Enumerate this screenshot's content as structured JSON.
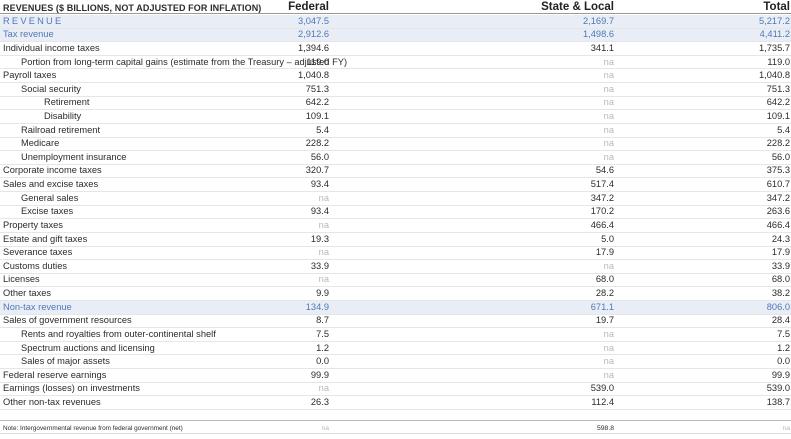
{
  "header": {
    "caption": "REVENUES ($ BILLIONS, NOT ADJUSTED FOR INFLATION)",
    "federal": "Federal",
    "state_local": "State & Local",
    "total": "Total"
  },
  "rows": [
    {
      "label": "REVENUE",
      "indent": 0,
      "federal": "3,047.5",
      "state_local": "2,169.7",
      "total": "5,217.2",
      "highlight": true
    },
    {
      "label": "Tax revenue",
      "indent": 0,
      "federal": "2,912.6",
      "state_local": "1,498.6",
      "total": "4,411.2",
      "highlight": true
    },
    {
      "label": "Individual income taxes",
      "indent": 0,
      "federal": "1,394.6",
      "state_local": "341.1",
      "total": "1,735.7"
    },
    {
      "label": "Portion from long-term capital gains (estimate from the Treasury – adjusted FY)",
      "indent": 1,
      "federal": "119.0",
      "state_local": "na",
      "total": "119.0"
    },
    {
      "label": "Payroll taxes",
      "indent": 0,
      "federal": "1,040.8",
      "state_local": "na",
      "total": "1,040.8"
    },
    {
      "label": "Social security",
      "indent": 1,
      "federal": "751.3",
      "state_local": "na",
      "total": "751.3"
    },
    {
      "label": "Retirement",
      "indent": 2,
      "federal": "642.2",
      "state_local": "na",
      "total": "642.2"
    },
    {
      "label": "Disability",
      "indent": 2,
      "federal": "109.1",
      "state_local": "na",
      "total": "109.1"
    },
    {
      "label": "Railroad retirement",
      "indent": 1,
      "federal": "5.4",
      "state_local": "na",
      "total": "5.4"
    },
    {
      "label": "Medicare",
      "indent": 1,
      "federal": "228.2",
      "state_local": "na",
      "total": "228.2"
    },
    {
      "label": "Unemployment insurance",
      "indent": 1,
      "federal": "56.0",
      "state_local": "na",
      "total": "56.0"
    },
    {
      "label": "Corporate income taxes",
      "indent": 0,
      "federal": "320.7",
      "state_local": "54.6",
      "total": "375.3"
    },
    {
      "label": "Sales and excise taxes",
      "indent": 0,
      "federal": "93.4",
      "state_local": "517.4",
      "total": "610.7"
    },
    {
      "label": "General sales",
      "indent": 1,
      "federal": "na",
      "state_local": "347.2",
      "total": "347.2"
    },
    {
      "label": "Excise taxes",
      "indent": 1,
      "federal": "93.4",
      "state_local": "170.2",
      "total": "263.6"
    },
    {
      "label": "Property taxes",
      "indent": 0,
      "federal": "na",
      "state_local": "466.4",
      "total": "466.4"
    },
    {
      "label": "Estate and gift taxes",
      "indent": 0,
      "federal": "19.3",
      "state_local": "5.0",
      "total": "24.3"
    },
    {
      "label": "Severance taxes",
      "indent": 0,
      "federal": "na",
      "state_local": "17.9",
      "total": "17.9"
    },
    {
      "label": "Customs duties",
      "indent": 0,
      "federal": "33.9",
      "state_local": "na",
      "total": "33.9"
    },
    {
      "label": "Licenses",
      "indent": 0,
      "federal": "na",
      "state_local": "68.0",
      "total": "68.0"
    },
    {
      "label": "Other taxes",
      "indent": 0,
      "federal": "9.9",
      "state_local": "28.2",
      "total": "38.2"
    },
    {
      "label": "Non-tax revenue",
      "indent": 0,
      "federal": "134.9",
      "state_local": "671.1",
      "total": "806.0",
      "highlight": true
    },
    {
      "label": "Sales of government resources",
      "indent": 0,
      "federal": "8.7",
      "state_local": "19.7",
      "total": "28.4"
    },
    {
      "label": "Rents and royalties from outer-continental shelf",
      "indent": 1,
      "federal": "7.5",
      "state_local": "na",
      "total": "7.5"
    },
    {
      "label": "Spectrum auctions and licensing",
      "indent": 1,
      "federal": "1.2",
      "state_local": "na",
      "total": "1.2"
    },
    {
      "label": "Sales of major assets",
      "indent": 1,
      "federal": "0.0",
      "state_local": "na",
      "total": "0.0"
    },
    {
      "label": "Federal reserve earnings",
      "indent": 0,
      "federal": "99.9",
      "state_local": "na",
      "total": "99.9"
    },
    {
      "label": "Earnings (losses) on investments",
      "indent": 0,
      "federal": "na",
      "state_local": "539.0",
      "total": "539.0"
    },
    {
      "label": "Other non-tax revenues",
      "indent": 0,
      "federal": "26.3",
      "state_local": "112.4",
      "total": "138.7"
    }
  ],
  "note": {
    "label": "Note: Intergovernmental revenue from federal government (net)",
    "federal": "na",
    "state_local": "598.8",
    "total": "na"
  }
}
